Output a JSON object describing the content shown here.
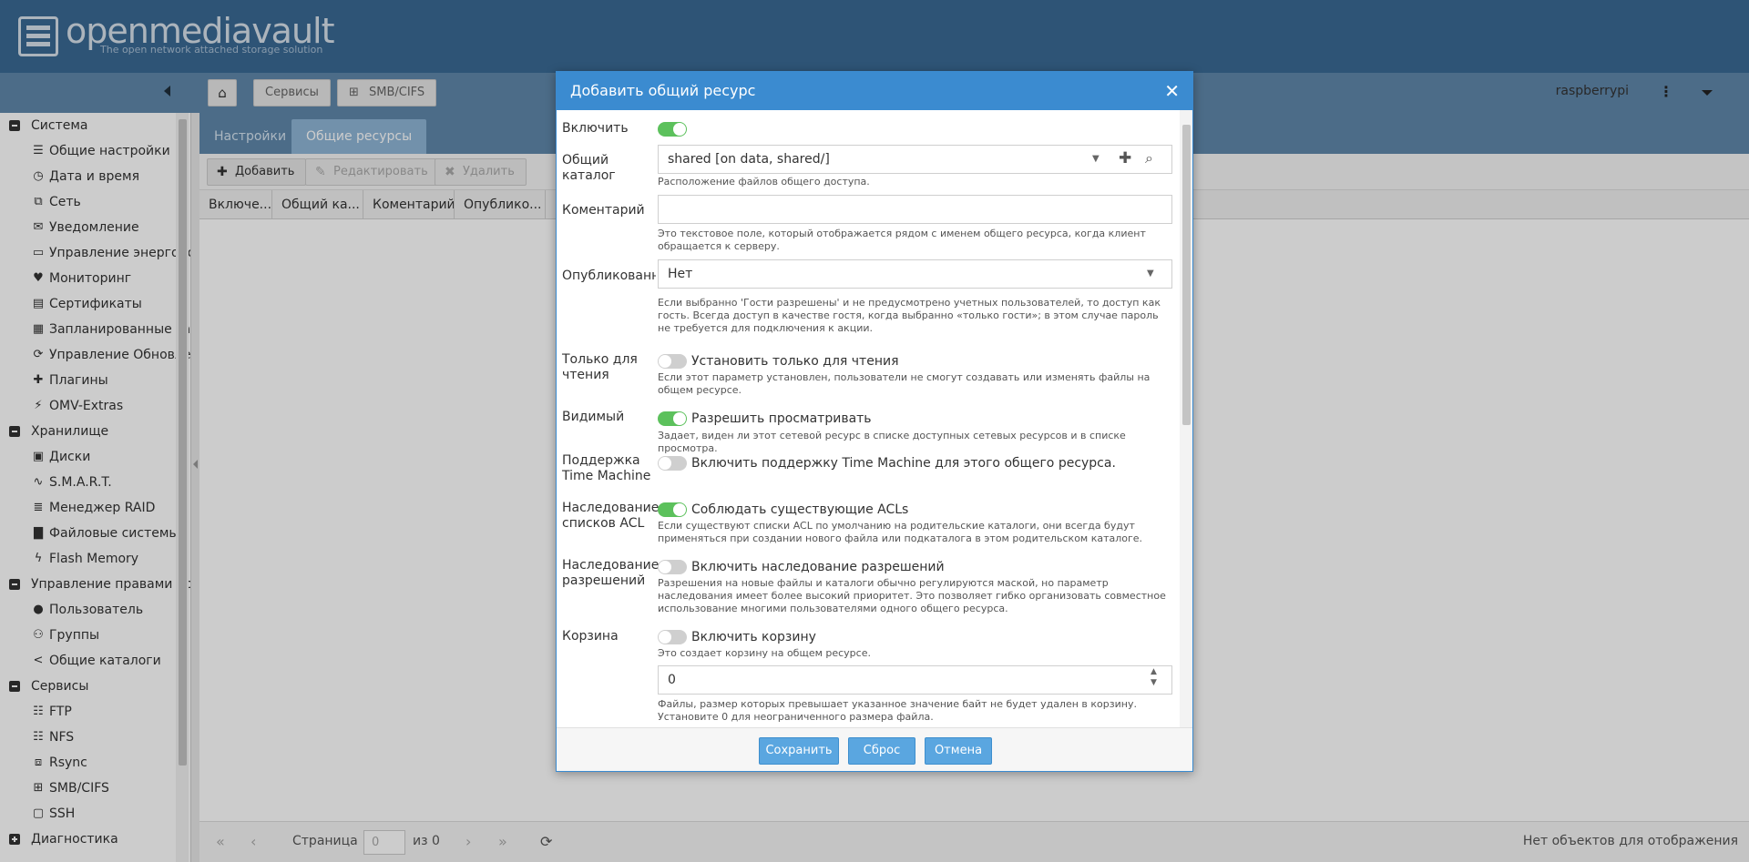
{
  "app": {
    "logo_text": "openmediavault",
    "logo_sub": "The open network attached storage solution",
    "user": "raspberrypi"
  },
  "breadcrumb": {
    "services": "Сервисы",
    "smb": "SMB/CIFS"
  },
  "sidebar": {
    "categories": {
      "system": "Система",
      "storage": "Хранилище",
      "access": "Управление правами доступа",
      "services": "Сервисы",
      "diagnostics": "Диагностика"
    },
    "items": [
      {
        "label": "Общие настройки",
        "icon": "sliders-icon"
      },
      {
        "label": "Дата и время",
        "icon": "clock-icon"
      },
      {
        "label": "Сеть",
        "icon": "network-icon"
      },
      {
        "label": "Уведомление",
        "icon": "envelope-icon"
      },
      {
        "label": "Управление энергопотреблением",
        "icon": "battery-icon"
      },
      {
        "label": "Мониторинг",
        "icon": "heartbeat-icon"
      },
      {
        "label": "Сертификаты",
        "icon": "certificate-icon"
      },
      {
        "label": "Запланированные задачи",
        "icon": "calendar-clock-icon"
      },
      {
        "label": "Управление Обновлениями",
        "icon": "refresh-icon"
      },
      {
        "label": "Плагины",
        "icon": "puzzle-icon"
      },
      {
        "label": "OMV-Extras",
        "icon": "plug-icon"
      },
      {
        "label": "Диски",
        "icon": "disk-icon"
      },
      {
        "label": "S.M.A.R.T.",
        "icon": "pulse-icon"
      },
      {
        "label": "Менеджер RAID",
        "icon": "database-icon"
      },
      {
        "label": "Файловые системы",
        "icon": "folders-icon"
      },
      {
        "label": "Flash Memory",
        "icon": "flash-icon"
      },
      {
        "label": "Пользователь",
        "icon": "user-icon"
      },
      {
        "label": "Группы",
        "icon": "users-icon"
      },
      {
        "label": "Общие каталоги",
        "icon": "share-icon"
      },
      {
        "label": "FTP",
        "icon": "server-icon"
      },
      {
        "label": "NFS",
        "icon": "server-icon"
      },
      {
        "label": "Rsync",
        "icon": "sync-icon"
      },
      {
        "label": "SMB/CIFS",
        "icon": "windows-icon"
      },
      {
        "label": "SSH",
        "icon": "terminal-icon"
      }
    ]
  },
  "tabs": {
    "settings": "Настройки",
    "shares": "Общие ресурсы"
  },
  "grid": {
    "add": "Добавить",
    "edit": "Редактировать",
    "delete": "Удалить",
    "columns": [
      "Включе...",
      "Общий ка...",
      "Коментарий",
      "Опублико..."
    ]
  },
  "pager": {
    "page_label": "Страница",
    "page_value": "0",
    "of_label": "из 0",
    "empty": "Нет объектов для отображения"
  },
  "dialog": {
    "title": "Добавить общий ресурс",
    "enable_label": "Включить",
    "shared_folder_label": "Общий каталог",
    "shared_folder_value": "shared [on data, shared/]",
    "shared_folder_help": "Расположение файлов общего доступа.",
    "comment_label": "Коментарий",
    "comment_value": "",
    "comment_help": "Это текстовое поле, который отображается рядом с именем общего ресурса, когда клиент обращается к серверу.",
    "public_label": "Опубликованный",
    "public_value": "Нет",
    "public_help": "Если выбранно 'Гости разрешены' и не предусмотрено учетных пользователей, то доступ как гость. Всегда доступ в качестве гостя, когда выбранно «только гости»; в этом случае пароль не требуется для подключения к акции.",
    "readonly_label": "Только для чтения",
    "readonly_toggle": "Установить только для чтения",
    "readonly_help": "Если этот параметр установлен, пользователи не смогут создавать или изменять файлы на общем ресурсе.",
    "visible_label": "Видимый",
    "visible_toggle": "Разрешить просматривать",
    "visible_help": "Задает, виден ли этот сетевой ресурс в списке доступных сетевых ресурсов и в списке просмотра.",
    "tm_label": "Поддержка Time Machine",
    "tm_toggle": "Включить поддержку Time Machine для этого общего ресурса.",
    "acl_label": "Наследование списков ACL",
    "acl_toggle": "Соблюдать существующие ACLs",
    "acl_help": "Если существуют списки ACL по умолчанию на родительские каталоги, они всегда будут применяться при создании нового файла или подкаталога в этом родительском каталоге.",
    "inherit_label": "Наследование разрешений",
    "inherit_toggle": "Включить наследование разрешений",
    "inherit_help": "Разрешения на новые файлы и каталоги обычно регулируются маской, но параметр наследования имеет более высокий приоритет. Это позволяет гибко организовать совместное использование многими пользователями одного общего ресурса.",
    "recycle_label": "Корзина",
    "recycle_toggle": "Включить корзину",
    "recycle_help": "Это создает корзину на общем ресурсе.",
    "maxsize_value": "0",
    "maxsize_help": "Файлы, размер которых превышает указанное значение байт не будет удален в корзину. Установите 0 для неограниченного размера файла.",
    "save": "Сохранить",
    "reset": "Сброс",
    "cancel": "Отмена"
  },
  "toggles": {
    "enable": true,
    "readonly": false,
    "visible": true,
    "timemachine": false,
    "acl": true,
    "inherit": false,
    "recycle": false
  },
  "colors": {
    "header": "#3a6a94",
    "toolbar": "#5f87ab",
    "dialog_accent": "#3b8bd0",
    "toggle_on": "#5cc15c"
  }
}
